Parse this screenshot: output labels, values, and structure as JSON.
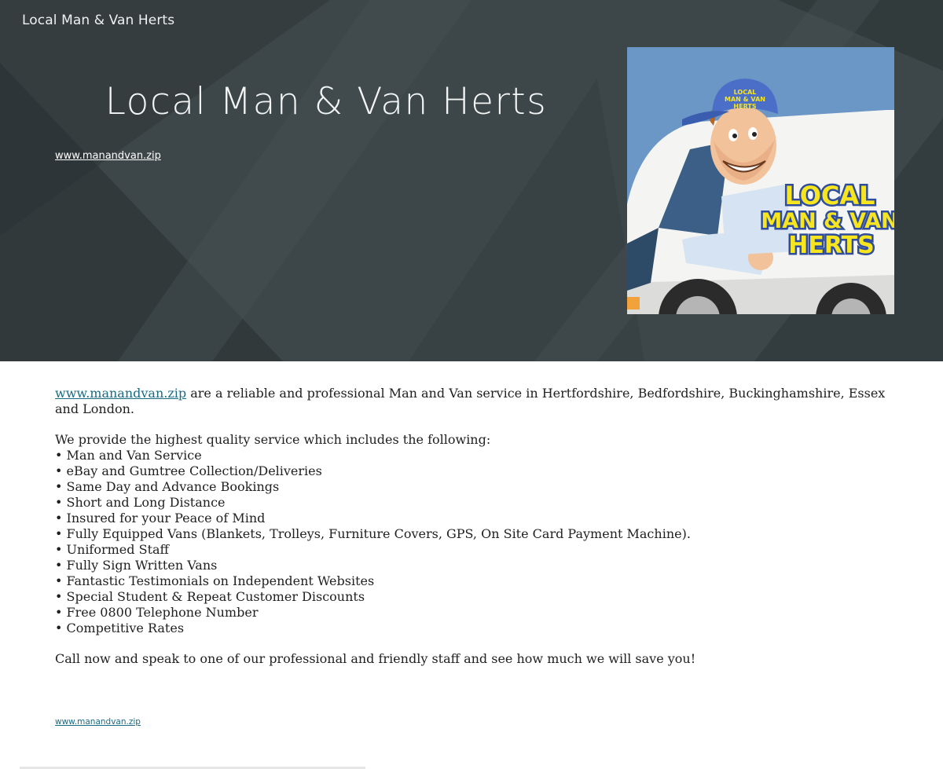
{
  "header": {
    "site_name": "Local Man & Van Herts"
  },
  "hero": {
    "title": "Local Man & Van Herts",
    "link_text": "www.manandvan.zip",
    "logo": {
      "line1": "LOCAL",
      "line2": "MAN & VAN",
      "line3": "HERTS",
      "cap_text_1": "LOCAL",
      "cap_text_2": "MAN & VAN",
      "cap_text_3": "HERTS"
    }
  },
  "content": {
    "intro_link": "www.manandvan.zip",
    "intro_text": " are a reliable and professional Man and Van service in Hertfordshire, Bedfordshire, Buckinghamshire, Essex and London.",
    "services_heading": "We provide the highest quality service which includes the following:",
    "services": [
      "• Man and Van Service",
      "• eBay and Gumtree Collection/Deliveries",
      "• Same Day and Advance Bookings",
      "• Short and Long Distance",
      "• Insured for your Peace of Mind",
      "• Fully Equipped Vans (Blankets, Trolleys, Furniture Covers, GPS, On Site Card Payment Machine).",
      "• Uniformed Staff",
      "• Fully Sign Written Vans",
      "• Fantastic Testimonials on Independent Websites",
      "• Special Student & Repeat Customer Discounts",
      "• Free 0800 Telephone Number",
      "• Competitive Rates"
    ],
    "call_to_action": "Call now and speak to one of our professional and friendly staff and see how much we will save you!"
  },
  "footer": {
    "link_text": "www.manandvan.zip"
  },
  "colors": {
    "hero_bg": "#3d4648",
    "link": "#1a6b82",
    "body_text": "#212121",
    "logo_yellow": "#f6e51f",
    "logo_blue": "#2f4d9c"
  }
}
